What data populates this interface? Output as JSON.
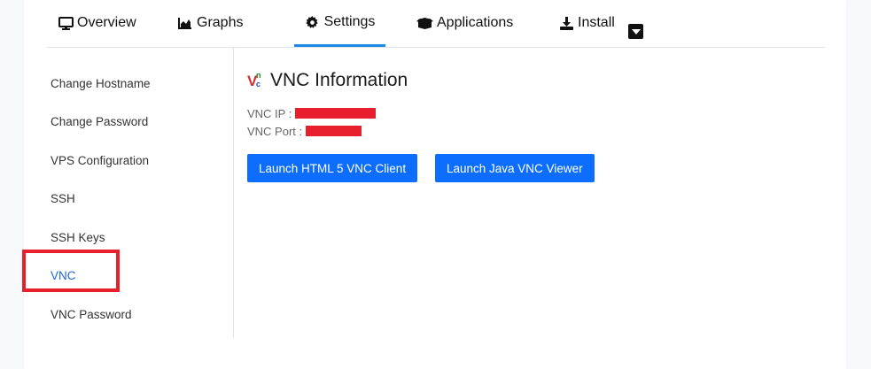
{
  "tabs": [
    {
      "label": "Overview",
      "icon": "monitor-icon"
    },
    {
      "label": "Graphs",
      "icon": "area-chart-icon"
    },
    {
      "label": "Settings",
      "icon": "gear-icon",
      "active": true
    },
    {
      "label": "Applications",
      "icon": "box-icon"
    },
    {
      "label": "Install",
      "icon": "download-icon"
    }
  ],
  "sidebar": {
    "items": [
      {
        "label": "Change Hostname"
      },
      {
        "label": "Change Password"
      },
      {
        "label": "VPS Configuration"
      },
      {
        "label": "SSH"
      },
      {
        "label": "SSH Keys"
      },
      {
        "label": "VNC",
        "active": true
      },
      {
        "label": "VNC Password"
      }
    ]
  },
  "vnc": {
    "title": "VNC Information",
    "ip_label": "VNC IP :",
    "port_label": "VNC Port :",
    "launch_html5_label": "Launch HTML 5 VNC Client",
    "launch_java_label": "Launch Java VNC Viewer"
  },
  "colors": {
    "accent": "#0d6efd",
    "active_link": "#1e66d6",
    "highlight": "#e8202d",
    "tab_underline": "#1e88e5"
  }
}
